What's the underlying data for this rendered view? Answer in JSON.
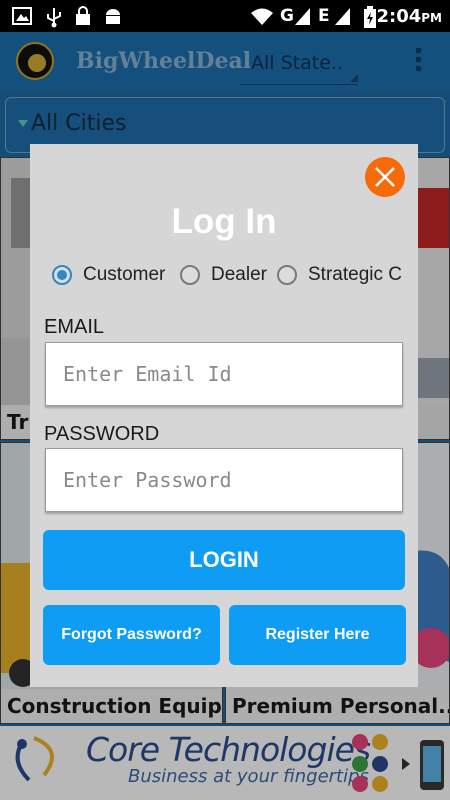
{
  "status_bar": {
    "network_letters": "G",
    "network_letters_2": "E",
    "time": "2:04",
    "ampm": "PM"
  },
  "app_bar": {
    "title": "BigWheelDeal",
    "state_select": "All State.."
  },
  "city_select": "All Cities",
  "tiles": {
    "top_left": "Tr",
    "bottom_left": "Construction Equip...",
    "bottom_right": "Premium Personal..."
  },
  "ad": {
    "title": "Core Technologies",
    "tagline": "Business at your fingertips"
  },
  "dialog": {
    "title": "Log In",
    "radio_options": [
      "Customer",
      "Dealer",
      "Strategic C"
    ],
    "selected_option": "Customer",
    "email_label": "EMAIL",
    "email_placeholder": "Enter Email Id",
    "password_label": "PASSWORD",
    "password_placeholder": "Enter Password",
    "login_label": "LOGIN",
    "forgot_label": "Forgot Password?",
    "register_label": "Register Here"
  },
  "colors": {
    "app_bar": "#1d6fae",
    "button": "#0e9cf5",
    "close": "#f66a0a",
    "dialog_bg": "#d6d6d6"
  },
  "icons": [
    "image-icon",
    "usb-icon",
    "lock-icon",
    "android-icon",
    "wifi-icon",
    "signal-icon",
    "battery-icon",
    "close-icon",
    "overflow-menu-icon"
  ]
}
